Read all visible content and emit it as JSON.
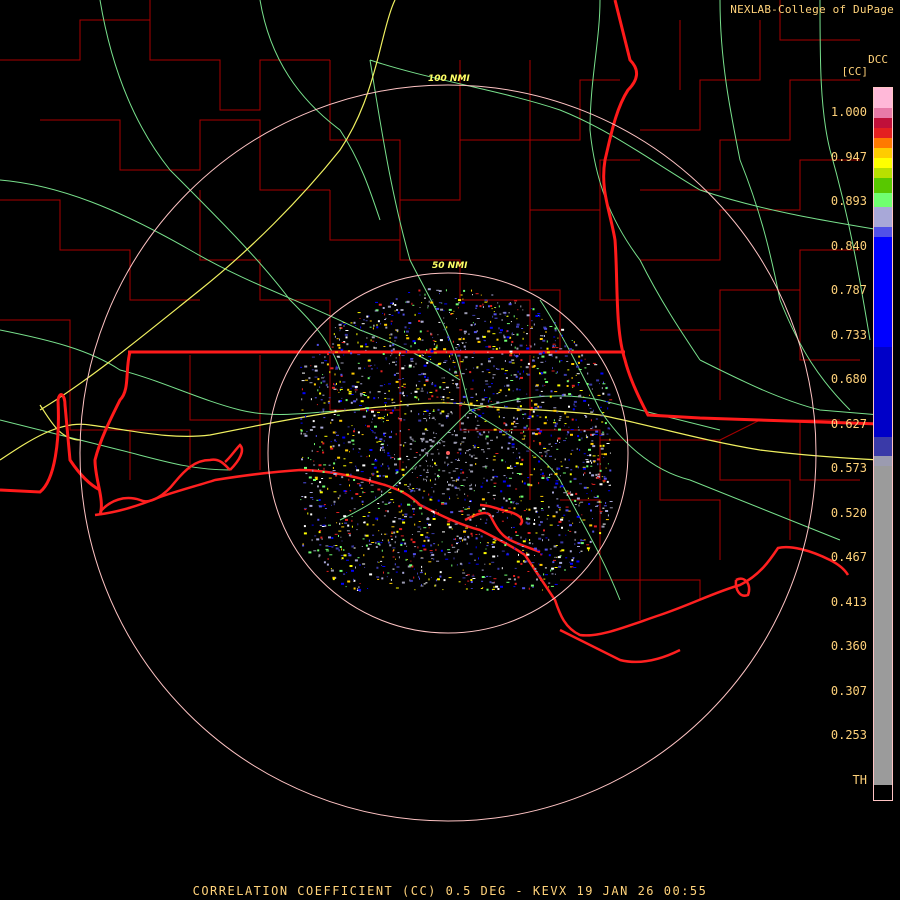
{
  "header": {
    "credit": "NEXLAB-College of DuPage",
    "site_code": "DCC",
    "units": "[CC]"
  },
  "rings": [
    {
      "label": "50 NMI"
    },
    {
      "label": "100 NMI"
    }
  ],
  "legend": {
    "ticks": [
      "1.000",
      "0.947",
      "0.893",
      "0.840",
      "0.787",
      "0.733",
      "0.680",
      "0.627",
      "0.573",
      "0.520",
      "0.467",
      "0.413",
      "0.360",
      "0.307",
      "0.253",
      "TH"
    ],
    "colors": [
      "#ffb8d8",
      "#e87aa8",
      "#c0103a",
      "#e42020",
      "#ff7a00",
      "#ffcc00",
      "#ffff00",
      "#b8e000",
      "#58c800",
      "#70ff70",
      "#a8a8d8",
      "#5050e8",
      "#0000ff",
      "#0000c8",
      "#3a3aa8",
      "#9b9bb0",
      "#9b9b9b",
      "#000000"
    ],
    "weights": [
      4,
      2,
      2,
      2,
      2,
      2,
      2,
      2,
      3,
      3,
      4,
      2,
      22,
      18,
      4,
      2,
      64,
      3
    ]
  },
  "caption": "CORRELATION COEFFICIENT (CC) 0.5 DEG - KEVX 19 JAN 26 00:55",
  "colors": {
    "background": "#000000",
    "state_border": "#ff1a1a",
    "county_line": "#b00000",
    "highway": "#78e08c",
    "interstate": "#f0f060",
    "range_ring": "#ffc4c4",
    "text": "#ffd27a"
  }
}
